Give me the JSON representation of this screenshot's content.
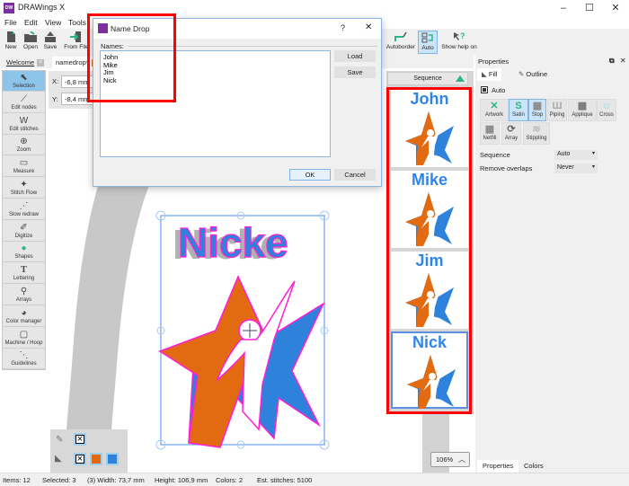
{
  "app": {
    "title": "DRAWings X",
    "logo_text": "DW",
    "window_controls": {
      "minimize": "–",
      "maximize": "☐",
      "close": "✕"
    }
  },
  "menu": [
    {
      "label": "File"
    },
    {
      "label": "Edit"
    },
    {
      "label": "View"
    },
    {
      "label": "Tools"
    }
  ],
  "toolbar": {
    "left": [
      {
        "label": "New",
        "icon": "new-document-icon"
      },
      {
        "label": "Open",
        "icon": "open-folder-icon"
      },
      {
        "label": "Save",
        "icon": "save-icon"
      },
      {
        "label": "From File",
        "icon": "import-from-file-icon"
      }
    ],
    "right": [
      {
        "label": "Autoborder",
        "icon": "autoborder-icon",
        "active": false
      },
      {
        "label": "Auto",
        "icon": "auto-icon",
        "active": true
      },
      {
        "label": "Show help on",
        "icon": "help-pointer-icon",
        "active": false
      }
    ]
  },
  "doc_tabs": [
    {
      "label": "Welcome",
      "active": false
    },
    {
      "label": "namedrop*",
      "active": true
    }
  ],
  "tools": [
    {
      "label": "Selection",
      "active": true
    },
    {
      "label": "Edit nodes"
    },
    {
      "label": "Edit stitches"
    },
    {
      "label": "Zoom"
    },
    {
      "label": "Measure"
    },
    {
      "label": "Stitch Flow"
    },
    {
      "label": "Slow redraw"
    },
    {
      "label": "Digitize"
    },
    {
      "label": "Shapes"
    },
    {
      "label": "Lettering"
    },
    {
      "label": "Arrays"
    },
    {
      "label": "Color manager"
    },
    {
      "label": "Machine / Hoop"
    },
    {
      "label": "Guidelines"
    }
  ],
  "position": {
    "x_label": "X:",
    "x_value": "-6,8 mm",
    "y_label": "Y:",
    "y_value": "-8,4 mm"
  },
  "dialog": {
    "title": "Name Drop",
    "help": "?",
    "close": "✕",
    "names_label": "Names:",
    "names_value": "John\nMike\nJim\nNick",
    "load_label": "Load",
    "save_label": "Save",
    "ok_label": "OK",
    "cancel_label": "Cancel"
  },
  "sequence": {
    "header": "Sequence",
    "items": [
      {
        "name": "John",
        "selected": false
      },
      {
        "name": "Mike",
        "selected": false
      },
      {
        "name": "Jim",
        "selected": false
      },
      {
        "name": "Nick",
        "selected": true
      }
    ]
  },
  "design": {
    "text": "Nicke",
    "colors": {
      "orange": "#e26a10",
      "blue": "#2e82dc",
      "outline": "#ff1fd6"
    }
  },
  "properties": {
    "title": "Properties",
    "tabs": [
      {
        "label": "Fill",
        "active": true
      },
      {
        "label": "Outline",
        "active": false
      }
    ],
    "auto_label": "Auto",
    "fill_types": [
      {
        "label": "Artwork",
        "active": false
      },
      {
        "label": "Satin",
        "active": true
      },
      {
        "label": "Stop",
        "active": true
      },
      {
        "label": "Piping",
        "active": false
      },
      {
        "label": "Applique",
        "active": false
      },
      {
        "label": "Cross",
        "active": false
      },
      {
        "label": "Netfill",
        "active": false
      },
      {
        "label": "Array",
        "active": false
      },
      {
        "label": "Stippling",
        "active": false
      }
    ],
    "sequence_label": "Sequence",
    "sequence_value": "Auto",
    "overlaps_label": "Remove overlaps",
    "overlaps_value": "Never",
    "bottom_tabs": [
      {
        "label": "Properties",
        "active": true
      },
      {
        "label": "Colors",
        "active": false
      }
    ]
  },
  "palette": {
    "swatches": [
      "#e26a10",
      "#2e82dc"
    ]
  },
  "zoom": {
    "value": "106%"
  },
  "status": {
    "items": "Items: 12",
    "selected": "Selected: 3",
    "width": "(3) Width: 73,7 mm",
    "height": "Height: 106,9 mm",
    "colors": "Colors: 2",
    "stitches": "Est. stitches: 5100"
  }
}
